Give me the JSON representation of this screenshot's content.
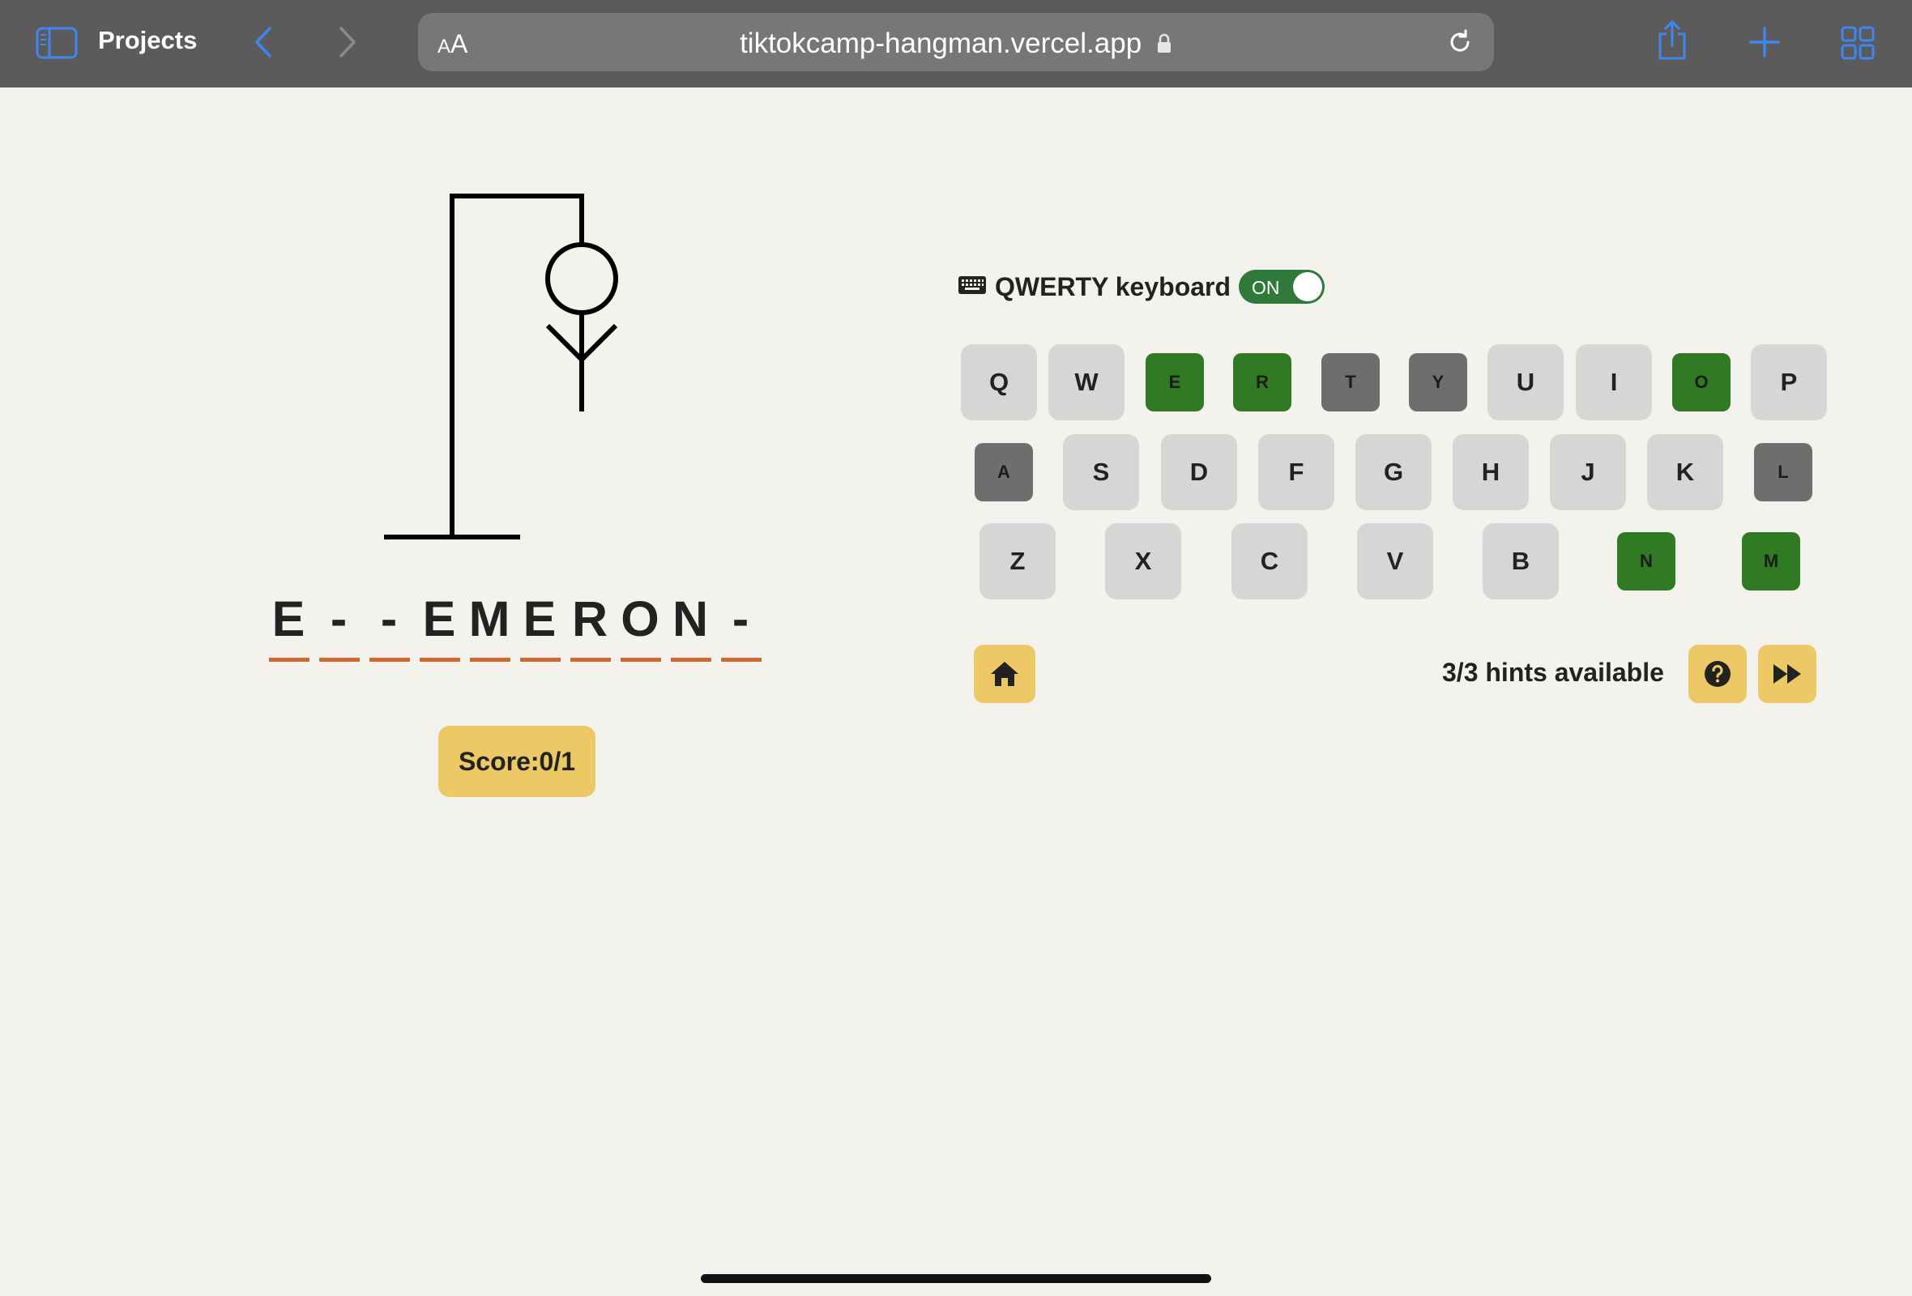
{
  "browser": {
    "sidebar_title": "Projects",
    "url_aa_small": "A",
    "url_aa_large": "A",
    "url": "tiktokcamp-hangman.vercel.app"
  },
  "colors": {
    "accent": "#ecc964",
    "correct": "#2f7a22",
    "wrong": "#6e6e6e",
    "unused": "#d6d6d6",
    "underline": "#cf6a2e",
    "toggle_on": "#2f7a3a"
  },
  "game": {
    "word_slots": [
      "E",
      "-",
      "-",
      "E",
      "M",
      "E",
      "R",
      "O",
      "N",
      "-"
    ],
    "score_label": "Score:0/1",
    "wrong_guesses": 4,
    "hangman_parts_drawn": [
      "head",
      "body",
      "left-arm",
      "right-arm"
    ]
  },
  "keyboard": {
    "icon": "keyboard-icon",
    "label": "QWERTY keyboard",
    "toggle_label": "ON",
    "rows": [
      [
        {
          "letter": "Q",
          "state": "unused"
        },
        {
          "letter": "W",
          "state": "unused"
        },
        {
          "letter": "E",
          "state": "correct"
        },
        {
          "letter": "R",
          "state": "correct"
        },
        {
          "letter": "T",
          "state": "wrong"
        },
        {
          "letter": "Y",
          "state": "wrong"
        },
        {
          "letter": "U",
          "state": "unused"
        },
        {
          "letter": "I",
          "state": "unused"
        },
        {
          "letter": "O",
          "state": "correct"
        },
        {
          "letter": "P",
          "state": "unused"
        }
      ],
      [
        {
          "letter": "A",
          "state": "wrong"
        },
        {
          "letter": "S",
          "state": "unused"
        },
        {
          "letter": "D",
          "state": "unused"
        },
        {
          "letter": "F",
          "state": "unused"
        },
        {
          "letter": "G",
          "state": "unused"
        },
        {
          "letter": "H",
          "state": "unused"
        },
        {
          "letter": "J",
          "state": "unused"
        },
        {
          "letter": "K",
          "state": "unused"
        },
        {
          "letter": "L",
          "state": "wrong"
        }
      ],
      [
        {
          "letter": "Z",
          "state": "unused"
        },
        {
          "letter": "X",
          "state": "unused"
        },
        {
          "letter": "C",
          "state": "unused"
        },
        {
          "letter": "V",
          "state": "unused"
        },
        {
          "letter": "B",
          "state": "unused"
        },
        {
          "letter": "N",
          "state": "correct"
        },
        {
          "letter": "M",
          "state": "correct"
        }
      ]
    ]
  },
  "controls": {
    "home_icon": "home-icon",
    "hints_text": "3/3 hints available",
    "hint_icon": "question-circle-icon",
    "skip_icon": "fast-forward-icon"
  }
}
